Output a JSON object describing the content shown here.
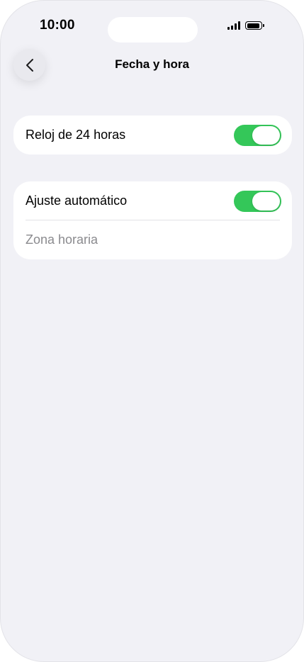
{
  "status_bar": {
    "time": "10:00",
    "signal_icon": "cellular-signal-icon",
    "battery_icon": "battery-icon",
    "battery_level": 0.9
  },
  "nav": {
    "back_icon": "chevron-left-icon",
    "title": "Fecha y hora"
  },
  "settings": {
    "clock_24h": {
      "label": "Reloj de 24 horas",
      "enabled": true
    },
    "auto_set": {
      "label": "Ajuste automático",
      "enabled": true
    },
    "timezone": {
      "label": "Zona horaria"
    }
  },
  "colors": {
    "toggle_on": "#34c759",
    "background": "#f1f1f6",
    "card": "#ffffff",
    "muted_text": "#8a8a8e"
  }
}
